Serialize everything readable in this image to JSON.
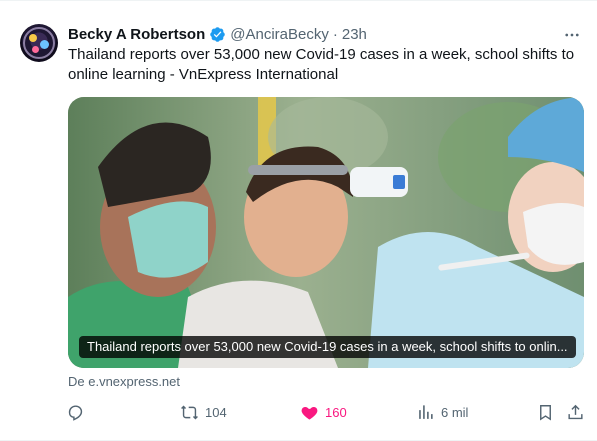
{
  "post": {
    "author_name": "Becky A Robertson",
    "handle": "@AnciraBecky",
    "separator": "·",
    "time": "23h",
    "text": "Thailand reports over 53,000 new Covid-19 cases in a week, school shifts to online learning - VnExpress International",
    "media": {
      "caption": "Thailand reports over 53,000 new Covid-19 cases in a week, school shifts to onlin..."
    },
    "source": "De e.vnexpress.net",
    "actions": {
      "reply_icon": "reply-icon",
      "retweet_icon": "retweet-icon",
      "retweets": "104",
      "like_icon": "heart-icon",
      "likes": "160",
      "views_icon": "views-icon",
      "views": "6 mil",
      "bookmark_icon": "bookmark-icon",
      "share_icon": "share-icon"
    }
  },
  "colors": {
    "text": "#0f1419",
    "muted": "#536471",
    "verified": "#1d9bf0",
    "liked": "#f91880",
    "border": "#eff3f4"
  }
}
